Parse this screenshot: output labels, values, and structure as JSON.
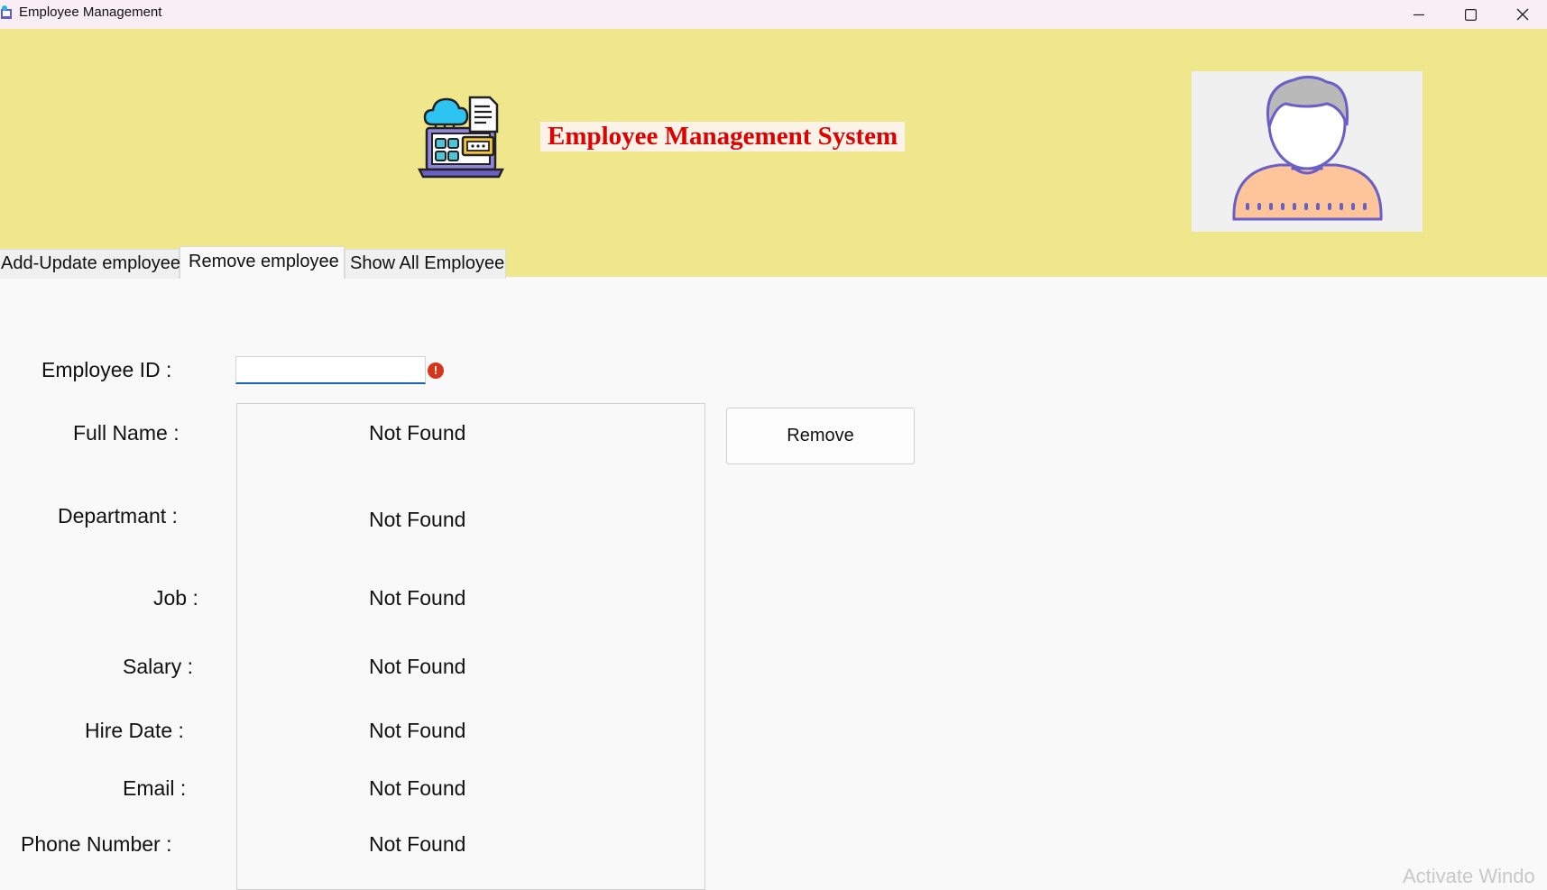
{
  "window": {
    "title": "Employee Management",
    "app_icon": "app-icon",
    "controls": [
      "minimize-icon",
      "maximize-icon",
      "close-icon"
    ]
  },
  "header": {
    "logo_icon": "employee-system-logo-icon",
    "title": "Employee Management System",
    "avatar_icon": "user-avatar-icon",
    "background": "#f0e68c",
    "title_color": "#e00000"
  },
  "tabs": [
    {
      "label": "Add-Update employee",
      "active": false
    },
    {
      "label": "Remove employee",
      "active": true
    },
    {
      "label": "Show All Employee",
      "active": false
    }
  ],
  "form": {
    "employee_id_label": "Employee ID :",
    "employee_id_value": "",
    "error_icon": "error-icon",
    "fields": [
      {
        "label": "Full Name :",
        "value": "Not Found"
      },
      {
        "label": "Departmant :",
        "value": "Not Found"
      },
      {
        "label": "Job :",
        "value": "Not Found"
      },
      {
        "label": "Salary :",
        "value": "Not Found"
      },
      {
        "label": "Hire Date :",
        "value": "Not Found"
      },
      {
        "label": "Email :",
        "value": "Not Found"
      },
      {
        "label": "Phone Number :",
        "value": "Not Found"
      }
    ],
    "remove_button": "Remove"
  },
  "watermark": "Activate Windo"
}
